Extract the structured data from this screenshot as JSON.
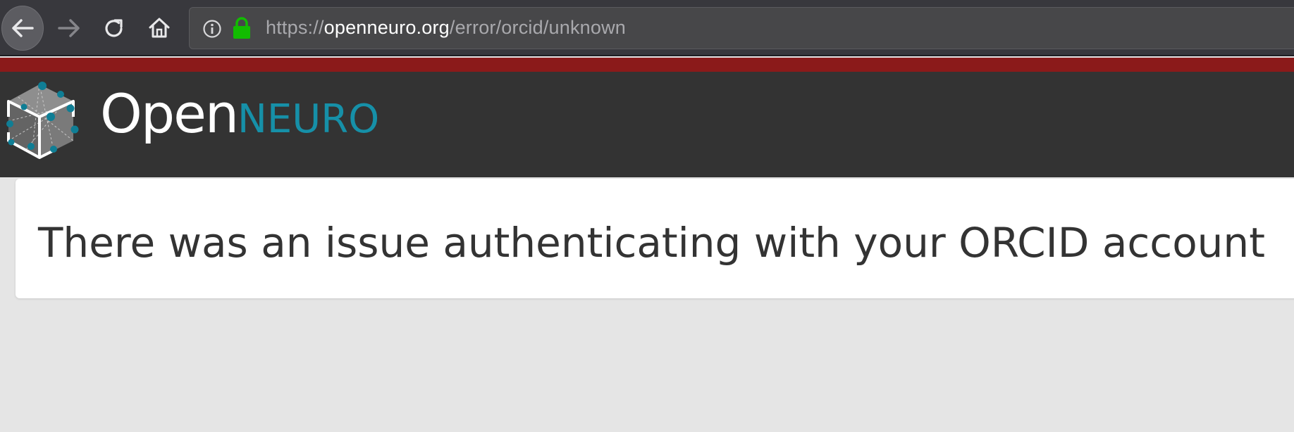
{
  "browser": {
    "url_scheme": "https://",
    "url_host": "openneuro.org",
    "url_path": "/error/orcid/unknown",
    "nav_icons": [
      "back-arrow-icon",
      "forward-arrow-icon",
      "reload-icon",
      "home-icon",
      "info-icon",
      "lock-icon"
    ],
    "lock_color": "#12bc00"
  },
  "header": {
    "logo_open": "Open",
    "logo_neuro": "NEURO",
    "brand_color": "#1690a8",
    "accent_stripe_color": "#8b1a1a"
  },
  "main": {
    "error_message": "There was an issue authenticating with your ORCID account"
  }
}
